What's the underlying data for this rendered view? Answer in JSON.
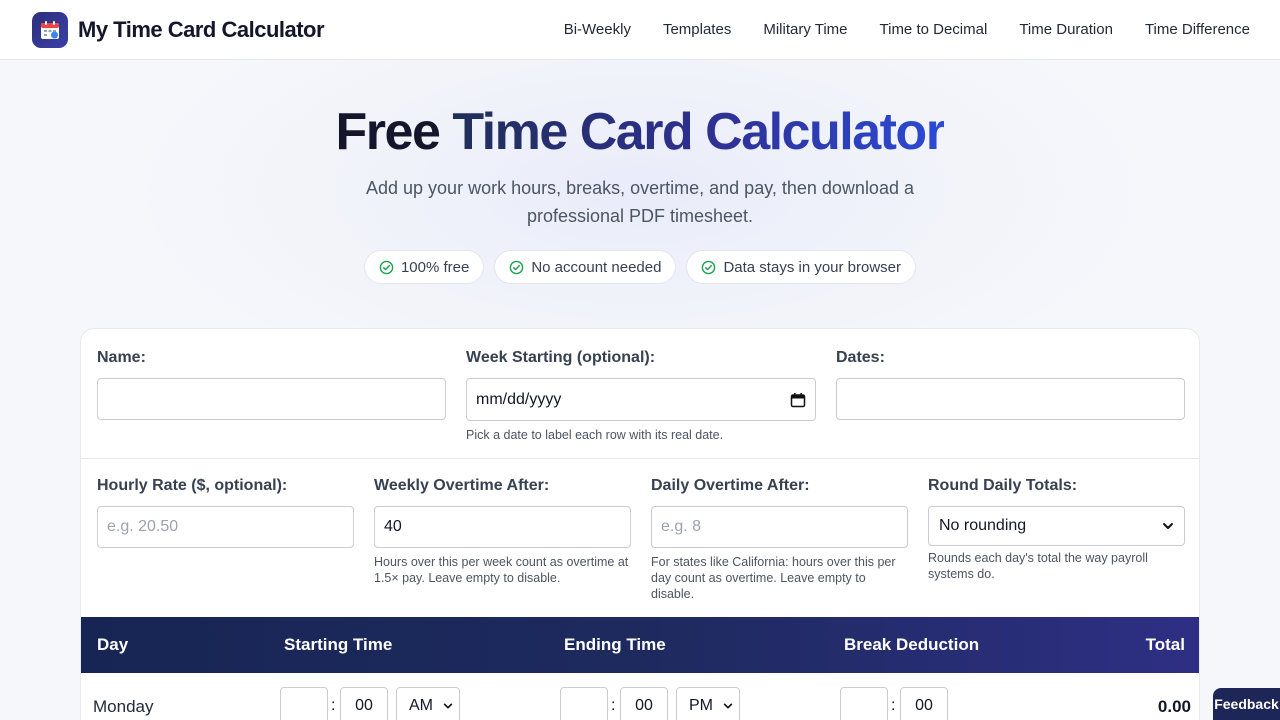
{
  "brand": {
    "name": "My Time Card Calculator",
    "logo_icon": "calendar-icon"
  },
  "nav": [
    "Bi-Weekly",
    "Templates",
    "Military Time",
    "Time to Decimal",
    "Time Duration",
    "Time Difference"
  ],
  "hero": {
    "title_plain": "Free",
    "title_accent": "Time Card Calculator",
    "subtitle": "Add up your work hours, breaks, overtime, and pay, then download a professional PDF timesheet.",
    "pills": [
      "100% free",
      "No account needed",
      "Data stays in your browser"
    ]
  },
  "form": {
    "name_label": "Name:",
    "name_value": "",
    "week_label": "Week Starting (optional):",
    "week_placeholder": "mm/dd/yyyy",
    "week_hint": "Pick a date to label each row with its real date.",
    "dates_label": "Dates:",
    "dates_value": "",
    "rate_label": "Hourly Rate ($, optional):",
    "rate_placeholder": "e.g. 20.50",
    "weekly_ot_label": "Weekly Overtime After:",
    "weekly_ot_value": "40",
    "weekly_ot_hint": "Hours over this per week count as overtime at 1.5× pay. Leave empty to disable.",
    "daily_ot_label": "Daily Overtime After:",
    "daily_ot_placeholder": "e.g. 8",
    "daily_ot_hint": "For states like California: hours over this per day count as overtime. Leave empty to disable.",
    "round_label": "Round Daily Totals:",
    "round_value": "No rounding",
    "round_hint": "Rounds each day's total the way payroll systems do."
  },
  "table": {
    "headers": {
      "day": "Day",
      "start": "Starting Time",
      "end": "Ending Time",
      "break": "Break Deduction",
      "total": "Total"
    },
    "rows": [
      {
        "day": "Monday",
        "start_hour": "",
        "start_min": "00",
        "start_ampm": "AM",
        "end_hour": "",
        "end_min": "00",
        "end_ampm": "PM",
        "break_hour": "",
        "break_min": "00",
        "total": "0.00"
      }
    ]
  },
  "feedback_label": "Feedback",
  "colors": {
    "accent": "#1e2557",
    "check": "#16a34a",
    "header_start": "#172554",
    "header_end": "#2e2f84"
  }
}
